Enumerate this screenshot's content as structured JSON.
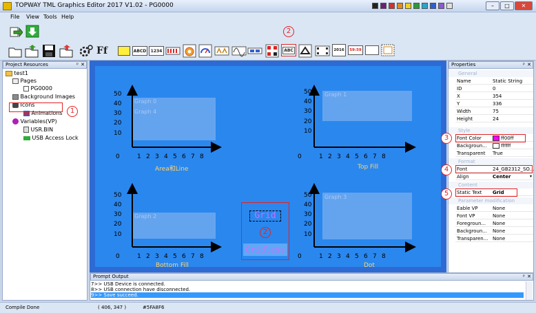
{
  "window": {
    "title": "TOPWAY TML Graphics Editor 2017 V1.02 - PG0000",
    "minimize": "–",
    "maximize": "□",
    "close": "✕"
  },
  "palette": [
    "#222222",
    "#6b1f7a",
    "#d0342c",
    "#e48b1b",
    "#f0d21c",
    "#2b9a3a",
    "#27a7c9",
    "#2f5fd1",
    "#8a5bd0",
    "#e0e0e0"
  ],
  "menu": [
    "File",
    "View",
    "Tools",
    "Help"
  ],
  "toolbar_text_icons": {
    "abcd": "ABCD",
    "num": "1234",
    "abc": "ABC",
    "date": "2016",
    "time": "59:59"
  },
  "project_resources": {
    "title": "Project Resources",
    "pin": "ᵖ",
    "close": "✕",
    "tree": [
      {
        "label": "test1",
        "icon": "folder-icon"
      },
      {
        "label": "Pages",
        "icon": "pages-icon"
      },
      {
        "label": "PG0000",
        "icon": "page-icon"
      },
      {
        "label": "Background Images",
        "icon": "images-icon"
      },
      {
        "label": "Icons",
        "icon": "icons-icon"
      },
      {
        "label": "Animations",
        "icon": "animations-icon"
      },
      {
        "label": "Variables(VP)",
        "icon": "variables-icon"
      },
      {
        "label": "USR.BIN",
        "icon": "file-icon"
      },
      {
        "label": "USB Access Lock",
        "icon": "lock-icon"
      }
    ]
  },
  "canvas": {
    "graphs": [
      {
        "label1": "Graph 0",
        "label2": "Graph 4",
        "caption": "Area和Line"
      },
      {
        "label1": "Graph 1",
        "label2": "",
        "caption": "Top Fill"
      },
      {
        "label1": "Graph 2",
        "label2": "",
        "caption": "Bottom Fill"
      },
      {
        "label1": "Graph 3",
        "label2": "",
        "caption": "Dot"
      }
    ],
    "y_ticks": [
      "50",
      "40",
      "30",
      "20",
      "10"
    ],
    "x_ticks": [
      "0",
      "1",
      "2",
      "3",
      "4",
      "5",
      "6",
      "7",
      "8"
    ],
    "static_grid": "Grid",
    "static_gridless": "Gridless"
  },
  "annotations": {
    "n1": "1",
    "n2": "2",
    "n3": "3",
    "n4": "4",
    "n5": "5"
  },
  "properties": {
    "title": "Properties",
    "pin": "ᵖ",
    "close": "✕",
    "groups": {
      "general": "General",
      "style": "Style",
      "format": "Format",
      "content": "Content",
      "param": "Parameter modification"
    },
    "general": [
      {
        "k": "Name",
        "v": "Static String"
      },
      {
        "k": "ID",
        "v": "0"
      },
      {
        "k": "X",
        "v": "354"
      },
      {
        "k": "Y",
        "v": "336"
      },
      {
        "k": "Width",
        "v": "75"
      },
      {
        "k": "Height",
        "v": "24"
      }
    ],
    "style": [
      {
        "k": "Font Color",
        "v": "ff00ff",
        "swatch": "#ff00ff"
      },
      {
        "k": "Backgroun...",
        "v": "ffffff",
        "swatch": "#ffffff"
      },
      {
        "k": "Transparent",
        "v": "True"
      }
    ],
    "format": [
      {
        "k": "Font",
        "v": "24_GB2312_SO..."
      },
      {
        "k": "Align",
        "v": "Center"
      }
    ],
    "content": [
      {
        "k": "Static Text",
        "v": "Grid"
      }
    ],
    "param": [
      {
        "k": "Eable VP",
        "v": "None"
      },
      {
        "k": "Font VP",
        "v": "None"
      },
      {
        "k": "Foregroun...",
        "v": "None"
      },
      {
        "k": "Backgroun...",
        "v": "None"
      },
      {
        "k": "Transparen...",
        "v": "None"
      }
    ]
  },
  "prompt": {
    "title": "Prompt Output",
    "pin": "ᵖ",
    "close": "✕",
    "lines": [
      "7>> USB Device is connected.",
      "8>> USB connection have disconnected.",
      "9>> Save succeed."
    ]
  },
  "status": {
    "left": "Compile Done",
    "coords": "( 406, 347 )",
    "color": "#5FA8F6"
  }
}
